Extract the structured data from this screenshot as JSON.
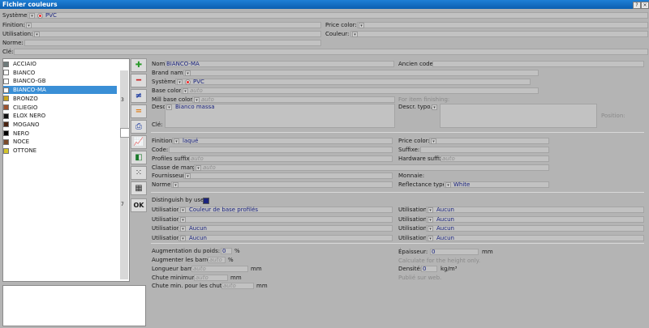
{
  "window": {
    "title": "Fichier couleurs"
  },
  "header": {
    "systeme": {
      "label": "Système:",
      "value": "PVC"
    },
    "finition": {
      "label": "Finition:"
    },
    "price_color": {
      "label": "Price color:"
    },
    "utilisation": {
      "label": "Utilisation:"
    },
    "couleur": {
      "label": "Couleur:"
    },
    "norme": {
      "label": "Norme:"
    },
    "cle": {
      "label": "Clé:"
    }
  },
  "colors": [
    {
      "name": "ACCIAIO",
      "color": "#6e7b7b"
    },
    {
      "name": "BIANCO",
      "color": "#ffffff"
    },
    {
      "name": "BIANCO-GB",
      "color": "#ffffff"
    },
    {
      "name": "BIANCO-MA",
      "color": "#ffffff"
    },
    {
      "name": "BRONZO",
      "color": "#c8a51e"
    },
    {
      "name": "CILIEGIO",
      "color": "#a0522d"
    },
    {
      "name": "ELOX NERO",
      "color": "#111111"
    },
    {
      "name": "MOGANO",
      "color": "#4a2412"
    },
    {
      "name": "NERO",
      "color": "#000000"
    },
    {
      "name": "NOCE",
      "color": "#7b4a2a"
    },
    {
      "name": "OTTONE",
      "color": "#d4c52a"
    }
  ],
  "side_numbers": {
    "a": "3",
    "b": "7"
  },
  "toolbar": {
    "ok": "OK"
  },
  "detail": {
    "nom": {
      "label": "Nom:",
      "value": "BIANCO-MA"
    },
    "ancien_code": {
      "label": "Ancien code:"
    },
    "brand_name": {
      "label": "Brand name:"
    },
    "systeme": {
      "label": "Système:",
      "value": "PVC"
    },
    "base_color": {
      "label": "Base color:",
      "value": "auto"
    },
    "mill_base_color": {
      "label": "Mill base color:",
      "value": "auto"
    },
    "for_item_finishing": "For item finishing:",
    "desc": {
      "label": "Desc:",
      "value": "Bianco massa"
    },
    "descr_typo": {
      "label": "Descr. typo.:"
    },
    "position": "Position:",
    "cle": {
      "label": "Clé:"
    },
    "finition": {
      "label": "Finition:",
      "value": "laqué"
    },
    "price_color": {
      "label": "Price color:"
    },
    "code": {
      "label": "Code:"
    },
    "suffixe": {
      "label": "Suffixe:"
    },
    "profiles_suffix": {
      "label": "Profiles suffix:",
      "value": "auto"
    },
    "hardware_suffix": {
      "label": "Hardware suffix:",
      "value": "auto"
    },
    "classe_marge": {
      "label": "Classe de marge:",
      "value": "auto"
    },
    "fournisseur": {
      "label": "Fournisseur:"
    },
    "monnaie": {
      "label": "Monnaie:"
    },
    "norme": {
      "label": "Norme:"
    },
    "reflectance": {
      "label": "Reflectance type:",
      "value": "White"
    },
    "distinguish": "Distinguish by use:",
    "util_label": "Utilisation:",
    "util_left": [
      "Couleur de base profilés",
      "",
      "Aucun",
      "Aucun"
    ],
    "util_right": [
      "Aucun",
      "Aucun",
      "Aucun",
      "Aucun"
    ],
    "aug_poids": {
      "label": "Augmentation du poids:",
      "value": "0",
      "unit": "%"
    },
    "aug_barres": {
      "label": "Augmenter les barres:",
      "value": "auto",
      "unit": "%"
    },
    "longueur_barre": {
      "label": "Longueur barre:",
      "value": "auto",
      "unit": "mm"
    },
    "chute_min": {
      "label": "Chute minimum:",
      "value": "auto",
      "unit": "mm"
    },
    "chute_min_chutes": {
      "label": "Chute min. pour les chutes:",
      "value": "auto",
      "unit": "mm"
    },
    "epaisseur": {
      "label": "Épaisseur:",
      "value": "0",
      "unit": "mm"
    },
    "calc_height": "Calculate for the height only.",
    "densite": {
      "label": "Densité:",
      "value": "0",
      "unit": "kg/m³"
    },
    "publie": "Publié sur web."
  }
}
